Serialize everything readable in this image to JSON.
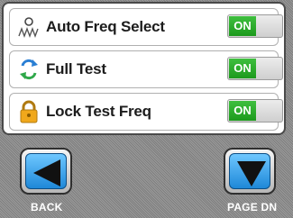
{
  "settings": {
    "rows": [
      {
        "label": "Auto Freq Select",
        "icon": "wave-antenna-icon",
        "toggle": "ON"
      },
      {
        "label": "Full Test",
        "icon": "swap-arrows-icon",
        "toggle": "ON"
      },
      {
        "label": "Lock Test Freq",
        "icon": "padlock-icon",
        "toggle": "ON"
      }
    ]
  },
  "nav": {
    "back_label": "BACK",
    "page_dn_label": "PAGE DN"
  },
  "colors": {
    "toggle_on": "#22a622",
    "nav_button": "#1e88d8"
  }
}
